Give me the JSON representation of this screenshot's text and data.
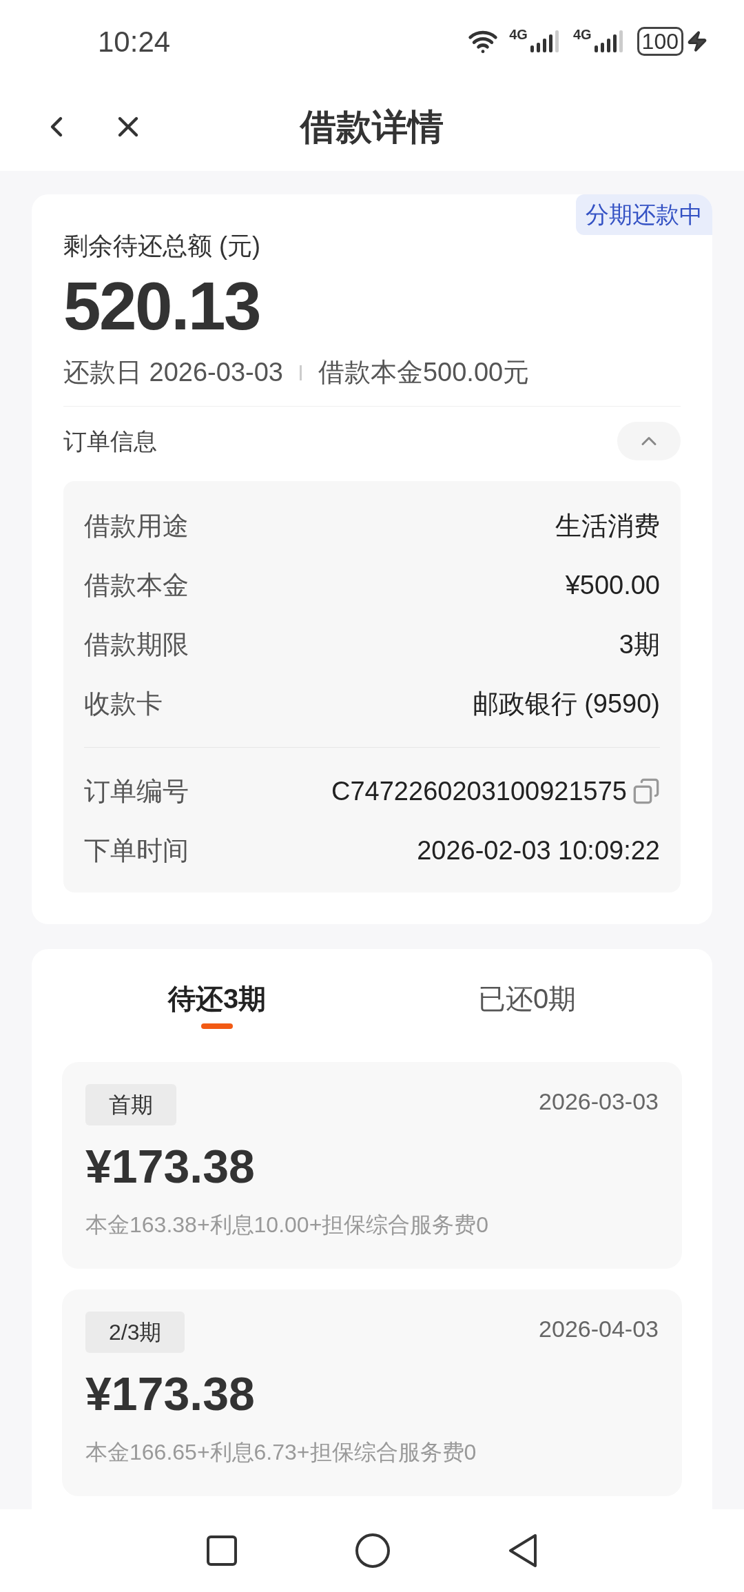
{
  "status_bar": {
    "time": "10:24",
    "networks": [
      "4G",
      "4G"
    ],
    "battery": "100"
  },
  "header": {
    "title": "借款详情"
  },
  "summary": {
    "badge": "分期还款中",
    "label": "剩余待还总额 (元)",
    "amount": "520.13",
    "due_date": "还款日 2026-03-03",
    "principal": "借款本金500.00元"
  },
  "order_info": {
    "title": "订单信息",
    "expanded": true,
    "rows": [
      {
        "label": "借款用途",
        "value": "生活消费"
      },
      {
        "label": "借款本金",
        "value": "¥500.00"
      },
      {
        "label": "借款期限",
        "value": "3期"
      },
      {
        "label": "收款卡",
        "value": "邮政银行 (9590)"
      }
    ],
    "meta_rows": [
      {
        "label": "订单编号",
        "value": "C7472260203100921575",
        "kind": "copy"
      },
      {
        "label": "下单时间",
        "value": "2026-02-03 10:09:22",
        "kind": "plain"
      }
    ]
  },
  "tabs": [
    {
      "label": "待还3期",
      "selected": true
    },
    {
      "label": "已还0期",
      "selected": false
    }
  ],
  "installments": [
    {
      "tag": "首期",
      "date": "2026-03-03",
      "amount": "¥173.38",
      "breakdown": "本金163.38+利息10.00+担保综合服务费0"
    },
    {
      "tag": "2/3期",
      "date": "2026-04-03",
      "amount": "¥173.38",
      "breakdown": "本金166.65+利息6.73+担保综合服务费0"
    }
  ]
}
